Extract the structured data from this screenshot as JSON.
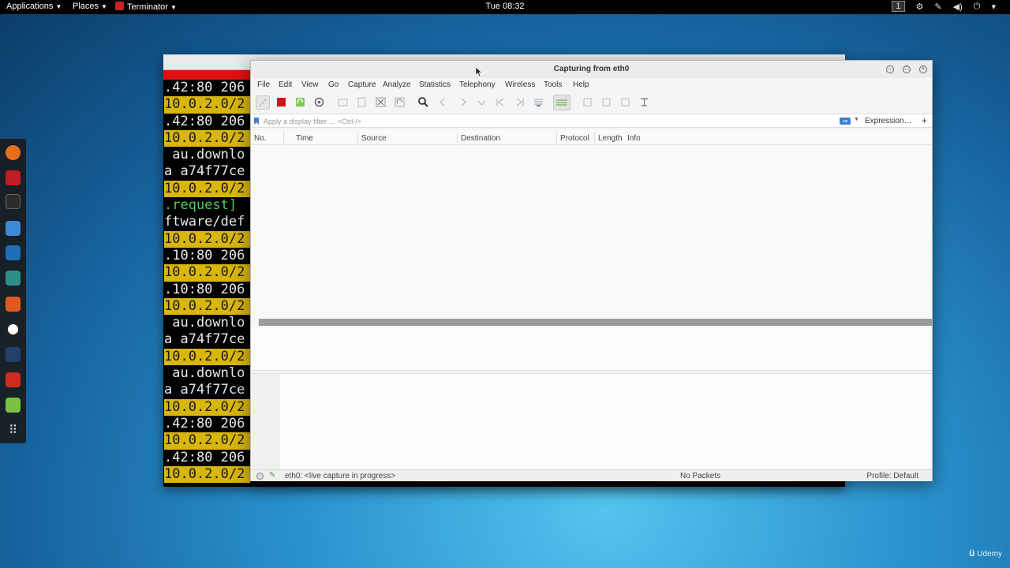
{
  "top_panel": {
    "applications": "Applications",
    "places": "Places",
    "terminator": "Terminator",
    "clock": "Tue 08:32",
    "workspace": "1"
  },
  "dock": {
    "items": [
      {
        "icon": "firefox-icon",
        "color": "#e76f1c"
      },
      {
        "icon": "metasploit-icon",
        "color": "#c41c24"
      },
      {
        "icon": "terminal-icon",
        "color": "#2b2b2b"
      },
      {
        "icon": "files-icon",
        "color": "#3f8ad6"
      },
      {
        "icon": "maltego-icon",
        "color": "#1e6fb5"
      },
      {
        "icon": "beef-icon",
        "color": "#2d8f8a"
      },
      {
        "icon": "burpsuite-icon",
        "color": "#e05a1d"
      },
      {
        "icon": "armitage-icon",
        "color": "#3aa04a"
      },
      {
        "icon": "faraday-icon",
        "color": "#233f6b"
      },
      {
        "icon": "flashbang-icon",
        "color": "#d12b1f"
      },
      {
        "icon": "leafpad-icon",
        "color": "#7ac143"
      },
      {
        "icon": "app-grid-icon",
        "color": "#cccccc"
      }
    ]
  },
  "terminal": {
    "lines": [
      {
        "text": ".42:80 206",
        "style": "white"
      },
      {
        "text": "10.0.2.0/2",
        "style": "yellow"
      },
      {
        "text": ".42:80 206",
        "style": "white"
      },
      {
        "text": "10.0.2.0/2",
        "style": "yellow"
      },
      {
        "text": " au.downlo",
        "style": "white"
      },
      {
        "text": "a a74f77ce",
        "style": "white"
      },
      {
        "text": "10.0.2.0/2",
        "style": "yellow"
      },
      {
        "text": ".request]",
        "style": "green"
      },
      {
        "text": "ftware/def",
        "style": "white"
      },
      {
        "text": "10.0.2.0/2",
        "style": "yellow"
      },
      {
        "text": ".10:80 206",
        "style": "white"
      },
      {
        "text": "10.0.2.0/2",
        "style": "yellow"
      },
      {
        "text": ".10:80 206",
        "style": "white"
      },
      {
        "text": "10.0.2.0/2",
        "style": "yellow"
      },
      {
        "text": " au.downlo",
        "style": "white"
      },
      {
        "text": "a a74f77ce",
        "style": "white"
      },
      {
        "text": "10.0.2.0/2",
        "style": "yellow"
      },
      {
        "text": " au.downlo",
        "style": "white"
      },
      {
        "text": "a a74f77ce",
        "style": "white"
      },
      {
        "text": "10.0.2.0/2",
        "style": "yellow"
      },
      {
        "text": ".42:80 206",
        "style": "white"
      },
      {
        "text": "10.0.2.0/2",
        "style": "yellow"
      },
      {
        "text": ".42:80 206",
        "style": "white"
      },
      {
        "text": "10.0.2.0/2",
        "style": "yellow"
      }
    ]
  },
  "wireshark": {
    "title": "Capturing from eth0",
    "menus": [
      "File",
      "Edit",
      "View",
      "Go",
      "Capture",
      "Analyze",
      "Statistics",
      "Telephony",
      "Wireless",
      "Tools",
      "Help"
    ],
    "filter": {
      "placeholder": "Apply a display filter … <Ctrl-/>",
      "expression": "Expression…",
      "add": "+"
    },
    "columns": [
      "No.",
      "Time",
      "Source",
      "Destination",
      "Protocol",
      "Length",
      "Info"
    ],
    "status": {
      "capture": "eth0: <live capture in progress>",
      "packets": "No Packets",
      "profile": "Profile: Default"
    }
  },
  "watermark": "Udemy"
}
